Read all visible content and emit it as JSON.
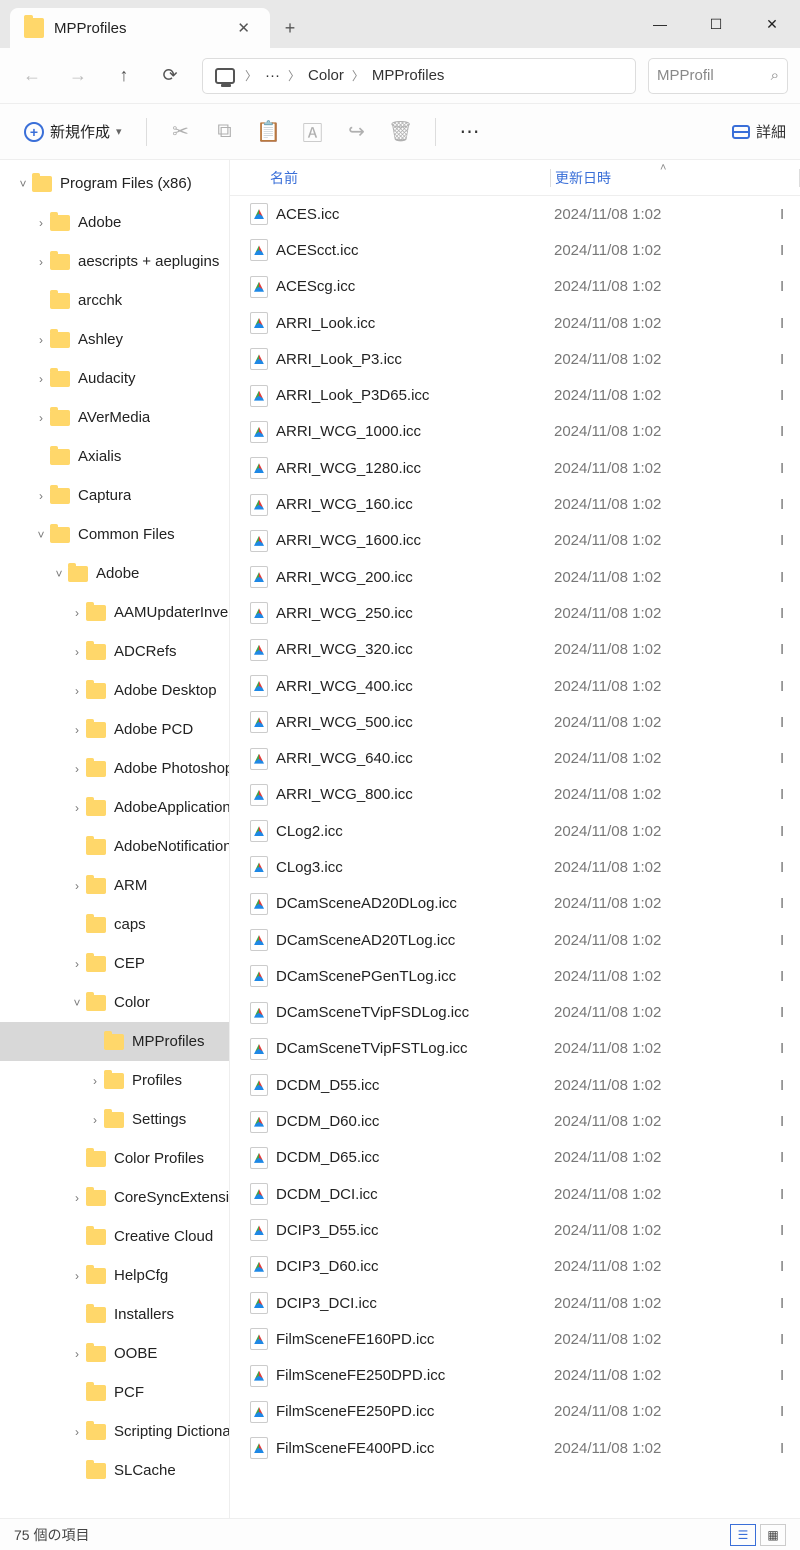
{
  "tab": {
    "title": "MPProfiles"
  },
  "window": {
    "min": "—",
    "max": "☐",
    "close": "✕",
    "newtab": "+"
  },
  "nav": {
    "back": "←",
    "fwd": "→",
    "up": "↑",
    "refresh": "⟳"
  },
  "breadcrumb": {
    "dots": "···",
    "seg1": "Color",
    "seg2": "MPProfiles"
  },
  "search": {
    "placeholder": "MPProfil",
    "icon": "⌕"
  },
  "toolbar": {
    "new_label": "新規作成",
    "cut": "✂",
    "copy": "⧉",
    "paste": "📋",
    "rename": "🄰",
    "share": "↪",
    "delete": "🗑",
    "more": "⋯",
    "detail_label": "詳細"
  },
  "tree": [
    {
      "d": 1,
      "tw": "v",
      "label": "Program Files (x86)"
    },
    {
      "d": 2,
      "tw": ">",
      "label": "Adobe"
    },
    {
      "d": 2,
      "tw": ">",
      "label": "aescripts + aeplugins"
    },
    {
      "d": 2,
      "tw": "",
      "label": "arcchk"
    },
    {
      "d": 2,
      "tw": ">",
      "label": "Ashley"
    },
    {
      "d": 2,
      "tw": ">",
      "label": "Audacity"
    },
    {
      "d": 2,
      "tw": ">",
      "label": "AVerMedia"
    },
    {
      "d": 2,
      "tw": "",
      "label": "Axialis"
    },
    {
      "d": 2,
      "tw": ">",
      "label": "Captura"
    },
    {
      "d": 2,
      "tw": "v",
      "label": "Common Files"
    },
    {
      "d": 3,
      "tw": "v",
      "label": "Adobe"
    },
    {
      "d": 4,
      "tw": ">",
      "label": "AAMUpdaterInventory"
    },
    {
      "d": 4,
      "tw": ">",
      "label": "ADCRefs"
    },
    {
      "d": 4,
      "tw": ">",
      "label": "Adobe Desktop"
    },
    {
      "d": 4,
      "tw": ">",
      "label": "Adobe PCD"
    },
    {
      "d": 4,
      "tw": ">",
      "label": "Adobe Photoshop"
    },
    {
      "d": 4,
      "tw": ">",
      "label": "AdobeApplication"
    },
    {
      "d": 4,
      "tw": "",
      "label": "AdobeNotification"
    },
    {
      "d": 4,
      "tw": ">",
      "label": "ARM"
    },
    {
      "d": 4,
      "tw": "",
      "label": "caps"
    },
    {
      "d": 4,
      "tw": ">",
      "label": "CEP"
    },
    {
      "d": 4,
      "tw": "v",
      "label": "Color"
    },
    {
      "d": 5,
      "tw": "",
      "label": "MPProfiles",
      "sel": true
    },
    {
      "d": 5,
      "tw": ">",
      "label": "Profiles"
    },
    {
      "d": 5,
      "tw": ">",
      "label": "Settings"
    },
    {
      "d": 4,
      "tw": "",
      "label": "Color Profiles"
    },
    {
      "d": 4,
      "tw": ">",
      "label": "CoreSyncExtension"
    },
    {
      "d": 4,
      "tw": "",
      "label": "Creative Cloud"
    },
    {
      "d": 4,
      "tw": ">",
      "label": "HelpCfg"
    },
    {
      "d": 4,
      "tw": "",
      "label": "Installers"
    },
    {
      "d": 4,
      "tw": ">",
      "label": "OOBE"
    },
    {
      "d": 4,
      "tw": "",
      "label": "PCF"
    },
    {
      "d": 4,
      "tw": ">",
      "label": "Scripting Dictionaries"
    },
    {
      "d": 4,
      "tw": "",
      "label": "SLCache"
    }
  ],
  "columns": {
    "name": "名前",
    "date": "更新日時"
  },
  "date_common": "2024/11/08 1:02",
  "files": [
    "ACES.icc",
    "ACEScct.icc",
    "ACEScg.icc",
    "ARRI_Look.icc",
    "ARRI_Look_P3.icc",
    "ARRI_Look_P3D65.icc",
    "ARRI_WCG_1000.icc",
    "ARRI_WCG_1280.icc",
    "ARRI_WCG_160.icc",
    "ARRI_WCG_1600.icc",
    "ARRI_WCG_200.icc",
    "ARRI_WCG_250.icc",
    "ARRI_WCG_320.icc",
    "ARRI_WCG_400.icc",
    "ARRI_WCG_500.icc",
    "ARRI_WCG_640.icc",
    "ARRI_WCG_800.icc",
    "CLog2.icc",
    "CLog3.icc",
    "DCamSceneAD20DLog.icc",
    "DCamSceneAD20TLog.icc",
    "DCamScenePGenTLog.icc",
    "DCamSceneTVipFSDLog.icc",
    "DCamSceneTVipFSTLog.icc",
    "DCDM_D55.icc",
    "DCDM_D60.icc",
    "DCDM_D65.icc",
    "DCDM_DCI.icc",
    "DCIP3_D55.icc",
    "DCIP3_D60.icc",
    "DCIP3_DCI.icc",
    "FilmSceneFE160PD.icc",
    "FilmSceneFE250DPD.icc",
    "FilmSceneFE250PD.icc",
    "FilmSceneFE400PD.icc"
  ],
  "status": {
    "count": "75 個の項目"
  }
}
